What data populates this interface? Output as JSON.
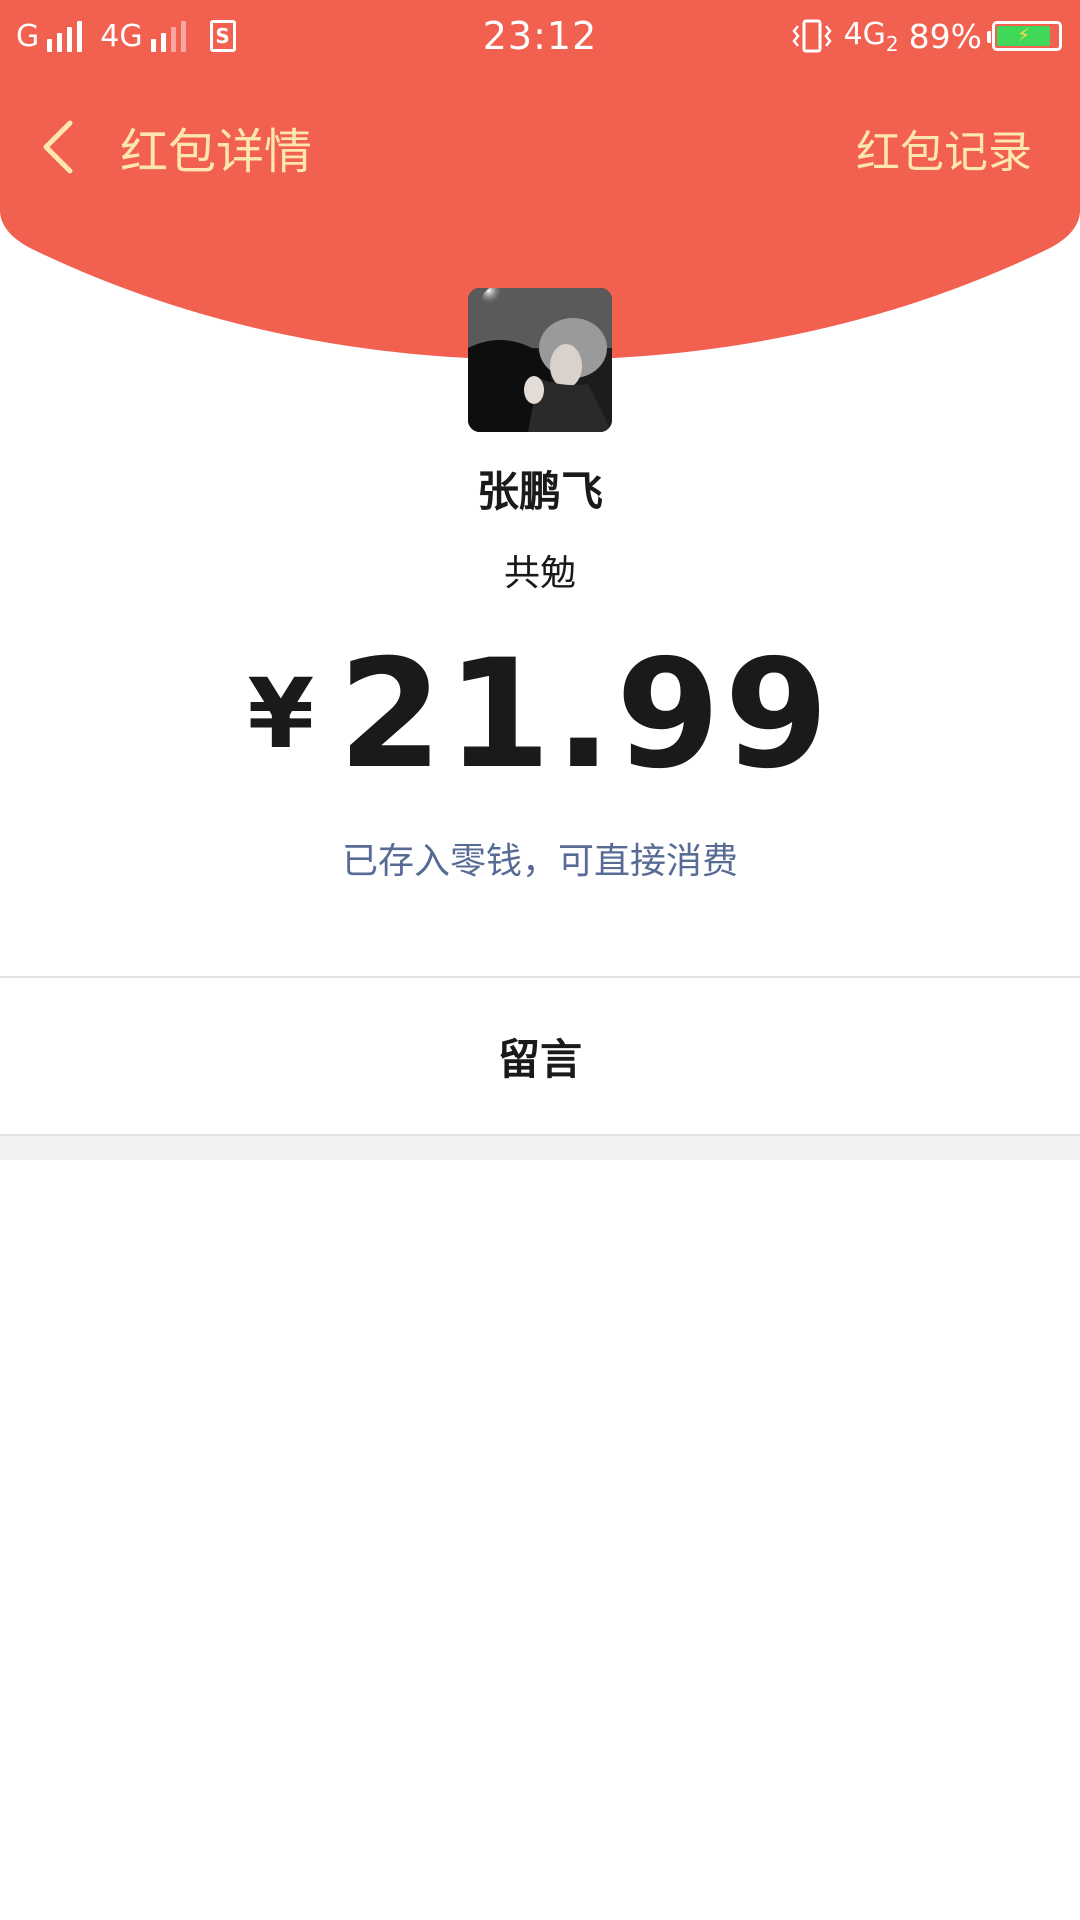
{
  "status_bar": {
    "carrier1": "G",
    "network1": "4G",
    "sim_label": "S",
    "time": "23:12",
    "network2": "4G",
    "network2_sub": "2",
    "battery_percent": "89%",
    "battery_level": 0.89
  },
  "nav": {
    "title": "红包详情",
    "record_link": "红包记录"
  },
  "packet": {
    "sender_name": "张鹏飞",
    "greeting": "共勉",
    "currency_symbol": "¥",
    "amount": "21.99",
    "wallet_note": "已存入零钱，可直接消费"
  },
  "message": {
    "label": "留言"
  },
  "colors": {
    "header_red": "#f2604f",
    "nav_text": "#fde6b2",
    "link_blue": "#576b95"
  },
  "icons": {
    "back": "chevron-left-icon",
    "vibrate": "vibrate-icon",
    "battery": "battery-charging-icon",
    "sim": "sim-card-icon"
  }
}
